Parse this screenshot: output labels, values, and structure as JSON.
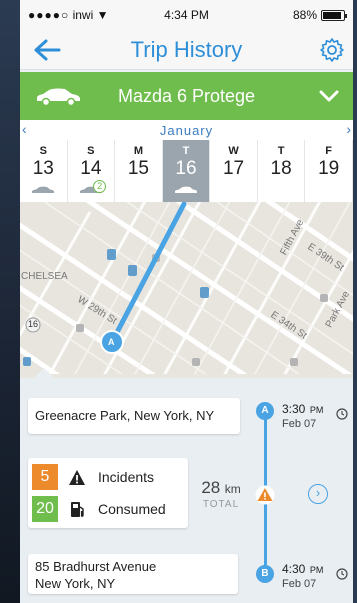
{
  "status_bar": {
    "signal": "●●●●○",
    "carrier": "inwi",
    "time": "4:34 PM",
    "battery_percent": "88%",
    "battery_level": 0.88
  },
  "header": {
    "title": "Trip History",
    "back_icon": "back-arrow-icon",
    "settings_icon": "gear-icon"
  },
  "vehicle": {
    "name": "Mazda 6 Protege",
    "icon": "car-icon",
    "dropdown_icon": "chevron-down-icon"
  },
  "calendar": {
    "month": "January",
    "prev": "‹",
    "next": "›",
    "days": [
      {
        "dow": "S",
        "num": "13",
        "has_trip": true,
        "badge": ""
      },
      {
        "dow": "S",
        "num": "14",
        "has_trip": true,
        "badge": "2"
      },
      {
        "dow": "M",
        "num": "15",
        "has_trip": false,
        "badge": ""
      },
      {
        "dow": "T",
        "num": "16",
        "has_trip": true,
        "badge": "",
        "selected": true
      },
      {
        "dow": "W",
        "num": "17",
        "has_trip": false,
        "badge": ""
      },
      {
        "dow": "T",
        "num": "18",
        "has_trip": false,
        "badge": ""
      },
      {
        "dow": "F",
        "num": "19",
        "has_trip": false,
        "badge": ""
      }
    ]
  },
  "map": {
    "labels": {
      "chelsea": "CHELSEA",
      "w29": "W 29th St",
      "fifth": "Fifth Ave",
      "e39": "E 39th St",
      "e34": "E 34th St",
      "park": "Park Ave",
      "route_16": "16"
    },
    "start_marker": "A"
  },
  "trip": {
    "start": {
      "address": "Greenacre Park, New York, NY",
      "marker": "A",
      "time": "3:30",
      "ampm": "PM",
      "date": "Feb 07"
    },
    "end": {
      "address_line1": "85 Bradhurst Avenue",
      "address_line2": "New York, NY",
      "marker": "B",
      "time": "4:30",
      "ampm": "PM",
      "date": "Feb 07"
    },
    "incidents": {
      "count": "5",
      "label": "Incidents"
    },
    "consumed": {
      "count": "20",
      "label": "Consumed"
    },
    "distance": {
      "value": "28",
      "unit": "km",
      "label": "TOTAL"
    },
    "more": "›"
  },
  "colors": {
    "accent": "#2e8fd8",
    "green": "#6fbd4c",
    "orange": "#ec8a2c",
    "route": "#4aa3e3"
  }
}
